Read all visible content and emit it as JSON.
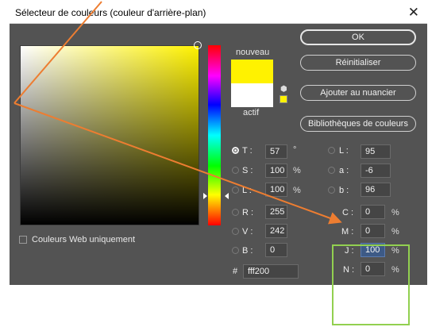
{
  "dialog": {
    "title": "Sélecteur de couleurs (couleur d'arrière-plan)",
    "close_glyph": "✕"
  },
  "swatches": {
    "new_label": "nouveau",
    "current_label": "actif",
    "new_color": "#fff200",
    "current_color": "#ffffff"
  },
  "buttons": {
    "ok": "OK",
    "reset": "Réinitialiser",
    "add_to_swatches": "Ajouter au nuancier",
    "color_libraries": "Bibliothèques de couleurs"
  },
  "hsb": {
    "h": {
      "label": "T :",
      "value": "57",
      "unit": "°",
      "selected": true
    },
    "s": {
      "label": "S :",
      "value": "100",
      "unit": "%"
    },
    "b": {
      "label": "L :",
      "value": "100",
      "unit": "%"
    }
  },
  "rgb": {
    "r": {
      "label": "R :",
      "value": "255"
    },
    "g": {
      "label": "V :",
      "value": "242"
    },
    "b": {
      "label": "B :",
      "value": "0"
    }
  },
  "lab": {
    "l": {
      "label": "L :",
      "value": "95"
    },
    "a": {
      "label": "a :",
      "value": "-6"
    },
    "b": {
      "label": "b :",
      "value": "96"
    }
  },
  "cmyk": {
    "c": {
      "label": "C :",
      "value": "0",
      "unit": "%"
    },
    "m": {
      "label": "M :",
      "value": "0",
      "unit": "%"
    },
    "y": {
      "label": "J :",
      "value": "100",
      "unit": "%"
    },
    "k": {
      "label": "N :",
      "value": "0",
      "unit": "%"
    }
  },
  "hex": {
    "label": "#",
    "value": "fff200"
  },
  "web_only": {
    "label": "Couleurs Web uniquement",
    "checked": false
  },
  "colors": {
    "dialog_bg": "#535353",
    "annotation_arrow": "#ed7d31",
    "annotation_box": "#92d050"
  }
}
